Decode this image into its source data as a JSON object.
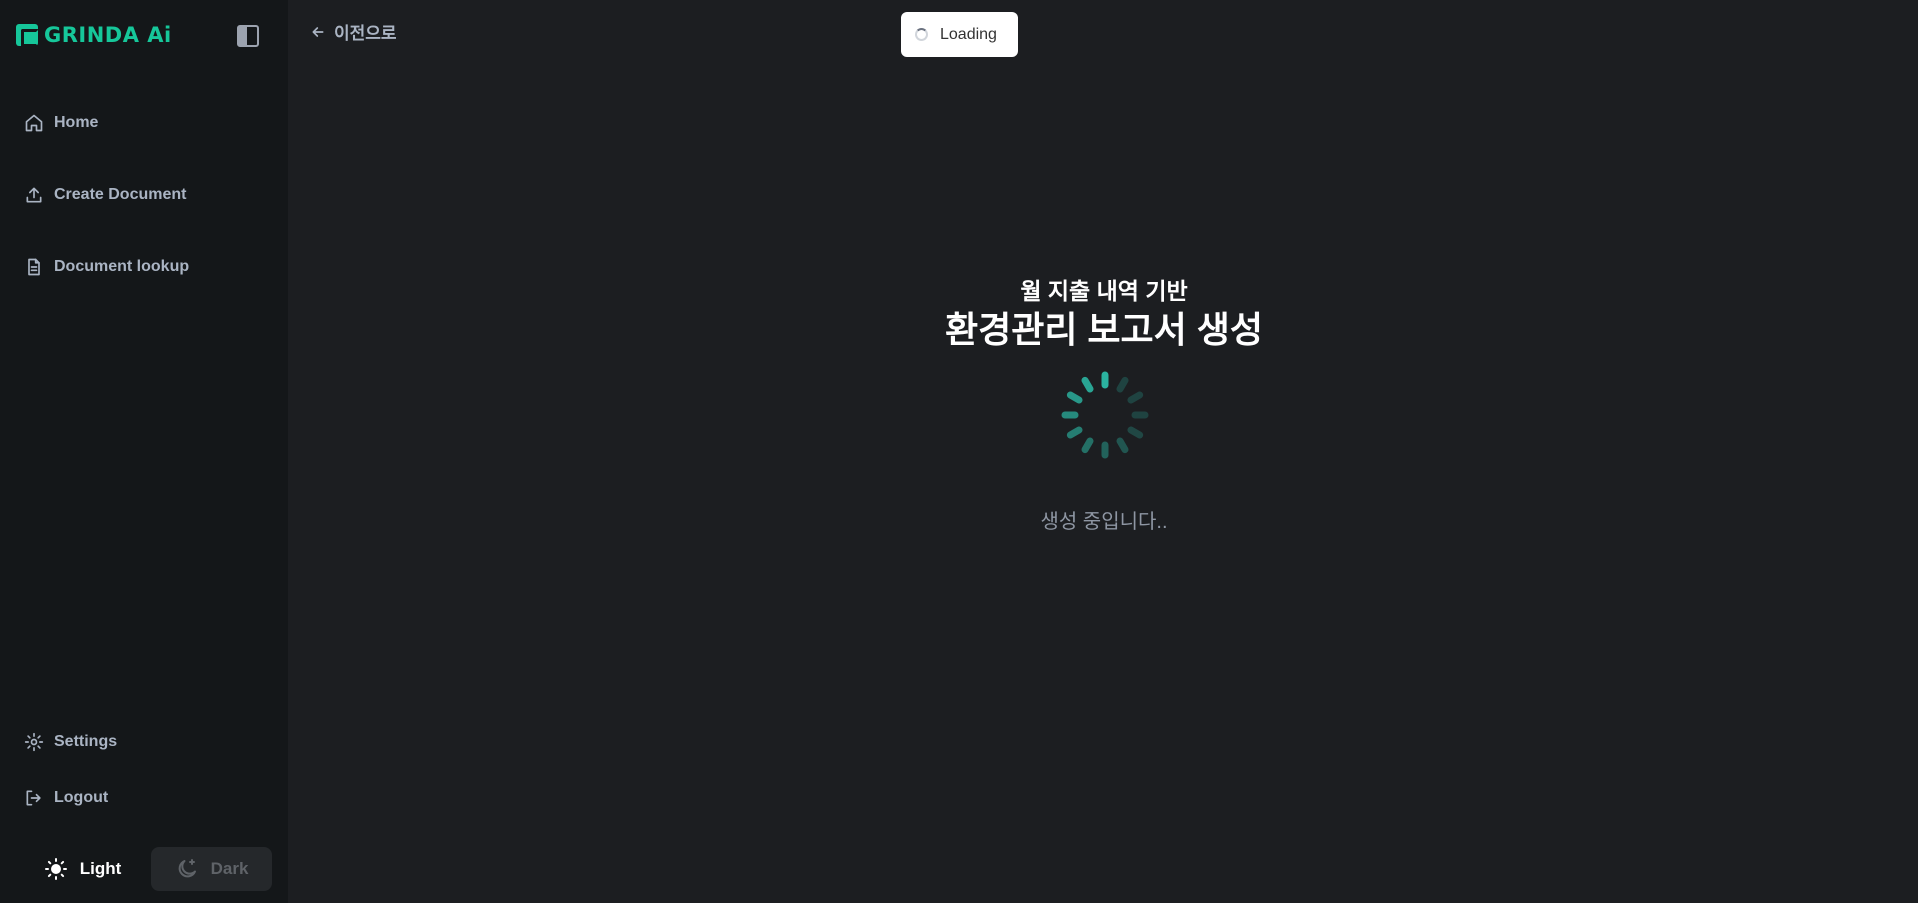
{
  "brand": {
    "name": "GRINDA Ai",
    "accent": "#16c79a"
  },
  "sidebar": {
    "collapse_icon": "sidebar-toggle-icon",
    "items": [
      {
        "label": "Home",
        "icon": "home-icon"
      },
      {
        "label": "Create Document",
        "icon": "upload-icon"
      },
      {
        "label": "Document lookup",
        "icon": "document-icon"
      }
    ],
    "bottom_items": [
      {
        "label": "Settings",
        "icon": "gear-icon"
      },
      {
        "label": "Logout",
        "icon": "logout-icon"
      }
    ],
    "theme": {
      "light_label": "Light",
      "dark_label": "Dark",
      "selected": "Light"
    }
  },
  "header": {
    "back_label": "이전으로"
  },
  "toast": {
    "label": "Loading"
  },
  "main": {
    "subtitle": "월 지출 내역 기반",
    "title": "환경관리 보고서 생성",
    "status": "생성 중입니다..",
    "spinner_color": "#2bb3a0"
  }
}
